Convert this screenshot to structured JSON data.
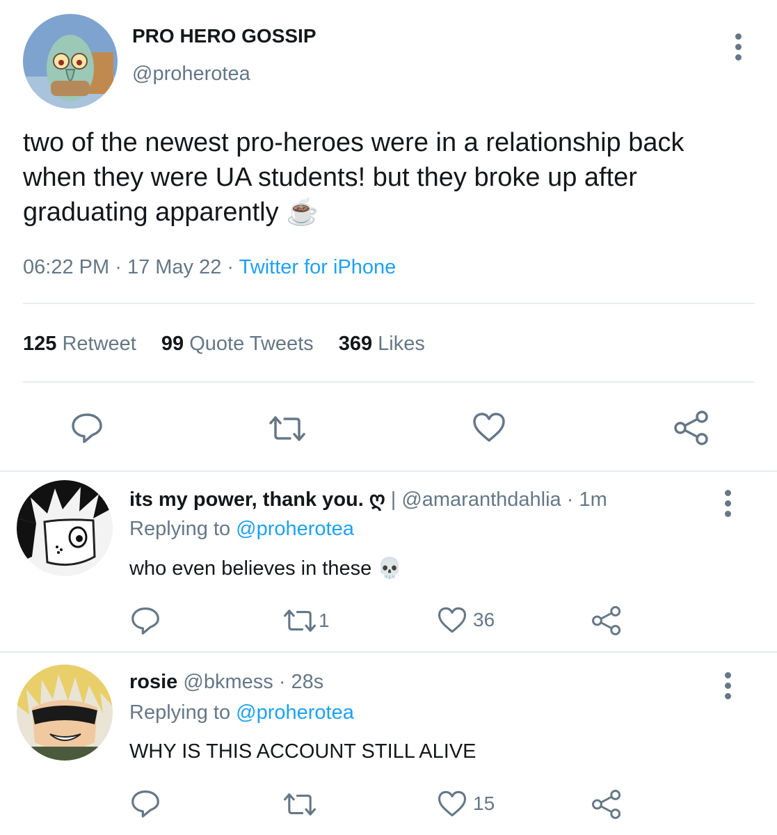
{
  "tweet": {
    "author_name": "PRO HERO GOSSIP",
    "author_handle": "@proherotea",
    "text": "two of the newest pro-heroes were in a relationship back when they were UA students! but they broke up after graduating apparently",
    "emoji": "☕",
    "time": "06:22 PM",
    "date": "17 May 22",
    "client": "Twitter for iPhone",
    "sep": "·",
    "stats": {
      "retweets_count": "125",
      "retweets_label": "Retweet",
      "quotes_count": "99",
      "quotes_label": "Quote Tweets",
      "likes_count": "369",
      "likes_label": "Likes"
    }
  },
  "replies": [
    {
      "name": "its my power, thank you. ღ",
      "separator": "|",
      "handle": "@amaranthdahlia",
      "time": "· 1m",
      "replying_prefix": "Replying to",
      "replying_handle": "@proherotea",
      "text": "who even believes in these",
      "emoji": "💀",
      "retweets": "1",
      "likes": "36"
    },
    {
      "name": "rosie",
      "handle": "@bkmess",
      "time": "· 28s",
      "replying_prefix": "Replying to",
      "replying_handle": "@proherotea",
      "text": "WHY IS THIS ACCOUNT STILL ALIVE",
      "retweets": "",
      "likes": "15"
    }
  ],
  "colors": {
    "accent": "#1da1f2",
    "icon": "#657786",
    "text": "#14171a",
    "divider": "#e6ecf0"
  },
  "icons": [
    "more-vertical-icon",
    "reply-icon",
    "retweet-icon",
    "like-icon",
    "share-icon"
  ]
}
